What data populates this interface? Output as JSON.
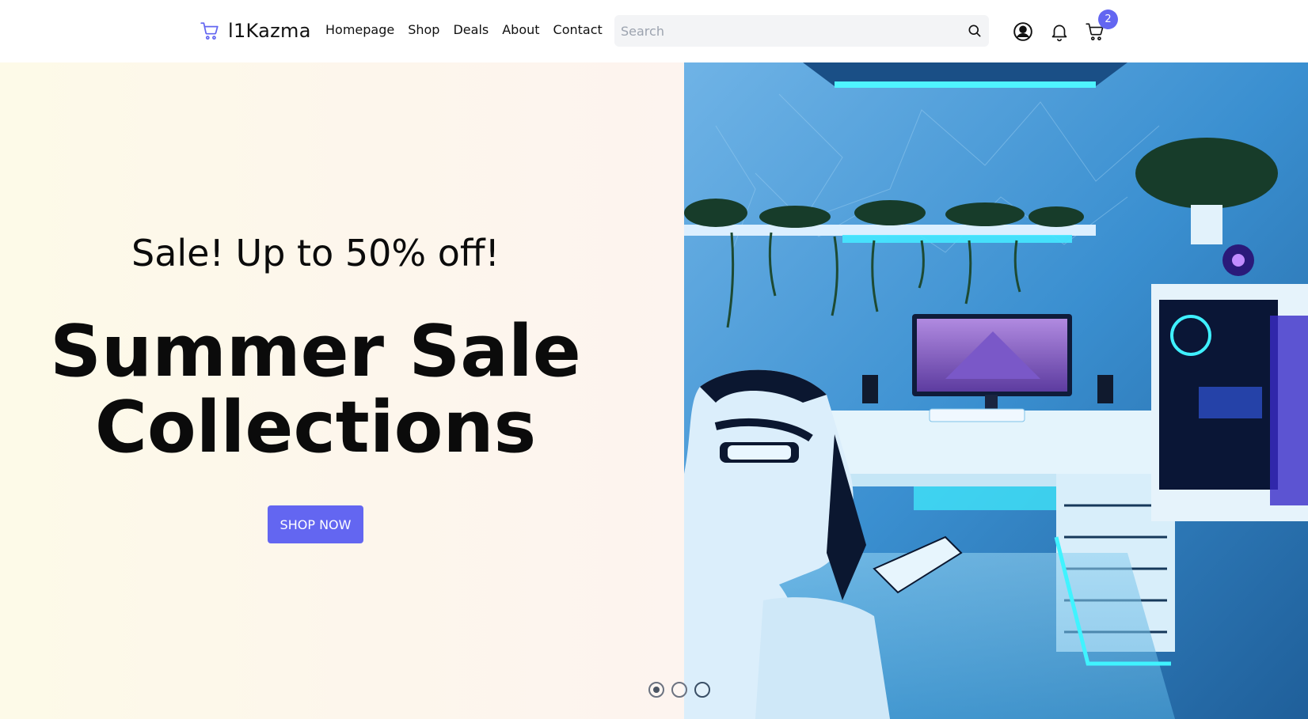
{
  "brand": {
    "name": "l1Kazma",
    "logo_icon": "shopping-cart-icon"
  },
  "nav": {
    "links": [
      "Homepage",
      "Shop",
      "Deals",
      "About",
      "Contact"
    ]
  },
  "search": {
    "placeholder": "Search",
    "value": "",
    "icon": "search-icon"
  },
  "header_icons": {
    "user": "user-circle-icon",
    "notifications": "bell-icon",
    "cart": "shopping-cart-icon",
    "cart_count": "2"
  },
  "hero": {
    "subtitle": "Sale! Up to 50% off!",
    "title_line1": "Summer Sale",
    "title_line2": "Collections",
    "cta": "SHOP NOW",
    "image_alt": "gaming room setup with blue LED lighting",
    "slides": 3,
    "active_slide": 1
  },
  "colors": {
    "accent": "#6366f1",
    "hero_bg": "#fdf8ea",
    "search_bg": "#f3f4f6"
  }
}
